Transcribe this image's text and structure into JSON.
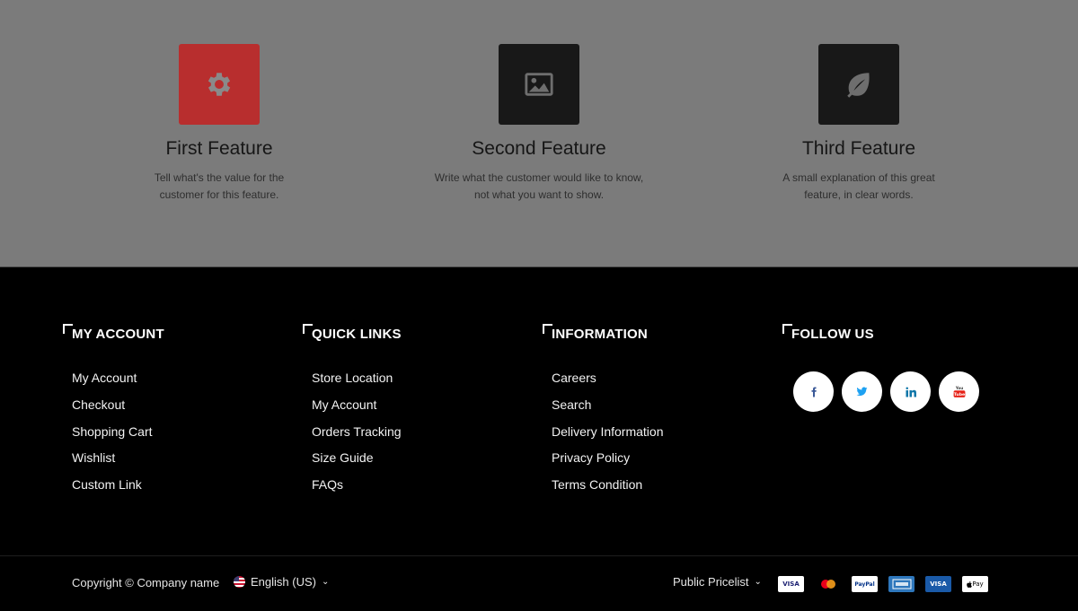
{
  "features": [
    {
      "icon": "gear-icon",
      "title": "First Feature",
      "line1": "Tell what's the value for the",
      "line2": "customer for this feature.",
      "box_color": "#b82e2e",
      "icon_color": "#8a8a8a"
    },
    {
      "icon": "image-icon",
      "title": "Second Feature",
      "line1": "Write what the customer would like to know,",
      "line2": "not what you want to show.",
      "box_color": "#181818",
      "icon_color": "#6e6e6e"
    },
    {
      "icon": "leaf-icon",
      "title": "Third Feature",
      "line1": "A small explanation of this great",
      "line2": "feature, in clear words.",
      "box_color": "#181818",
      "icon_color": "#6e6e6e"
    }
  ],
  "footer": {
    "my_account": {
      "title": "MY ACCOUNT",
      "links": [
        "My Account",
        "Checkout",
        "Shopping Cart",
        "Wishlist",
        "Custom Link"
      ]
    },
    "quick_links": {
      "title": "QUICK LINKS",
      "links": [
        "Store Location",
        "My Account",
        "Orders Tracking",
        "Size Guide",
        "FAQs"
      ]
    },
    "information": {
      "title": "INFORMATION",
      "links": [
        "Careers",
        "Search",
        "Delivery Information",
        "Privacy Policy",
        "Terms Condition"
      ]
    },
    "follow_us": {
      "title": "FOLLOW US",
      "social": [
        {
          "icon": "facebook-icon",
          "glyph": "f",
          "color": "#3b5998"
        },
        {
          "icon": "twitter-icon",
          "glyph": "🐦",
          "color": "#1da1f2"
        },
        {
          "icon": "linkedin-icon",
          "glyph": "in",
          "color": "#0e76a8"
        },
        {
          "icon": "youtube-icon",
          "glyph": "▶",
          "color": "#e62117"
        }
      ]
    }
  },
  "bottom": {
    "copyright": "Copyright © Company name",
    "language": "English (US)",
    "pricelist": "Public Pricelist",
    "payment_icons": [
      "visa-icon",
      "mastercard-icon",
      "paypal-icon",
      "amex-icon",
      "visa-electron-icon",
      "apple-pay-icon"
    ],
    "visa_label": "VISA",
    "paypal_label": "PayPal",
    "apple_pay_label": "Pay"
  }
}
